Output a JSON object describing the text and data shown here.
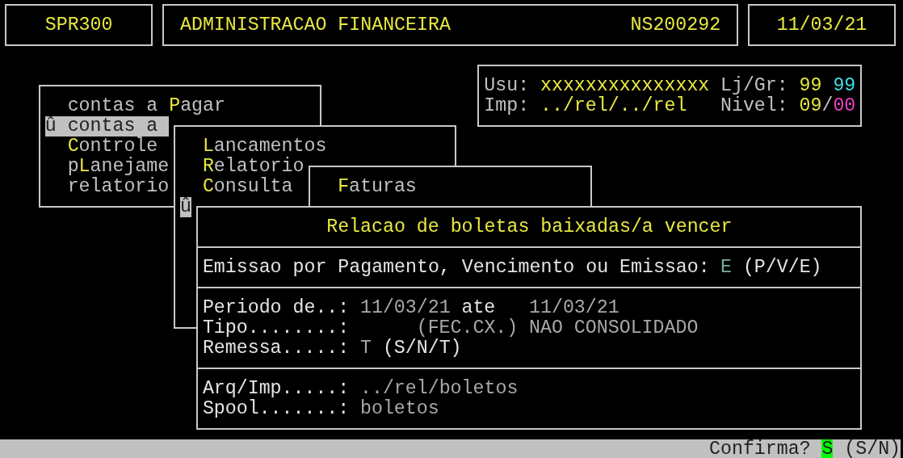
{
  "header": {
    "program": "SPR300",
    "title": "ADMINISTRACAO FINANCEIRA",
    "code": "NS200292",
    "date": "11/03/21"
  },
  "user_info": {
    "usu_label": "Usu:",
    "usu_value": "xxxxxxxxxxxxxxx",
    "ljgr_label": "Lj/Gr:",
    "imp_label": "Imp:",
    "imp_value": "../rel/../rel",
    "nivel_label": "Nivel:",
    "ljgr_values": [
      {
        "text": "99",
        "color": "#e8e840"
      },
      {
        "text": "99",
        "color": "#40e0e8"
      }
    ],
    "nivel_values": [
      {
        "text": "09",
        "color": "#e8e840"
      },
      {
        "text": "/",
        "color": "#c0c0c0"
      },
      {
        "text": "00",
        "color": "#f040c8"
      }
    ]
  },
  "menus": [
    {
      "cursor": "û",
      "items": [
        {
          "selected": false,
          "segments": [
            {
              "text": "contas a ",
              "hot": false
            },
            {
              "text": "P",
              "hot": true
            },
            {
              "text": "agar",
              "hot": false
            }
          ]
        },
        {
          "selected": true,
          "segments": [
            {
              "text": "contas a",
              "hot": false
            }
          ]
        },
        {
          "selected": false,
          "segments": [
            {
              "text": "C",
              "hot": true
            },
            {
              "text": "ontrole",
              "hot": false
            }
          ]
        },
        {
          "selected": false,
          "segments": [
            {
              "text": "p",
              "hot": false
            },
            {
              "text": "L",
              "hot": true
            },
            {
              "text": "anejame",
              "hot": false
            }
          ]
        },
        {
          "selected": false,
          "segments": [
            {
              "text": "relatorio",
              "hot": false
            }
          ]
        }
      ]
    },
    {
      "cursor": "û",
      "items": [
        {
          "selected": false,
          "segments": [
            {
              "text": "L",
              "hot": true
            },
            {
              "text": "ancamentos",
              "hot": false
            }
          ]
        },
        {
          "selected": false,
          "segments": [
            {
              "text": "R",
              "hot": true
            },
            {
              "text": "elatorio",
              "hot": false
            }
          ]
        },
        {
          "selected": false,
          "segments": [
            {
              "text": "C",
              "hot": true
            },
            {
              "text": "onsulta",
              "hot": false
            }
          ]
        }
      ]
    },
    {
      "items": [
        {
          "selected": false,
          "segments": [
            {
              "text": "F",
              "hot": true
            },
            {
              "text": "aturas",
              "hot": false
            }
          ]
        }
      ]
    }
  ],
  "form": {
    "title": "Relacao de boletas baixadas/a vencer",
    "emissao": {
      "label": "Emissao por Pagamento, Vencimento ou Emissao:",
      "value": "E",
      "options": "(P/V/E)"
    },
    "periodo": {
      "label": "Periodo de..:",
      "from": "11/03/21",
      "separator": "ate",
      "to": "11/03/21"
    },
    "tipo": {
      "label": "Tipo........:",
      "code": "(FEC.CX.)",
      "description": "NAO CONSOLIDADO"
    },
    "remessa": {
      "label": "Remessa.....:",
      "value": "T",
      "options": "(S/N/T)"
    },
    "arq_imp": {
      "label": "Arq/Imp.....:",
      "value": "../rel/boletos"
    },
    "spool": {
      "label": "Spool.......:",
      "value": "boletos"
    }
  },
  "status_bar": {
    "prompt": "Confirma?",
    "value": "S",
    "options": "(S/N)"
  }
}
